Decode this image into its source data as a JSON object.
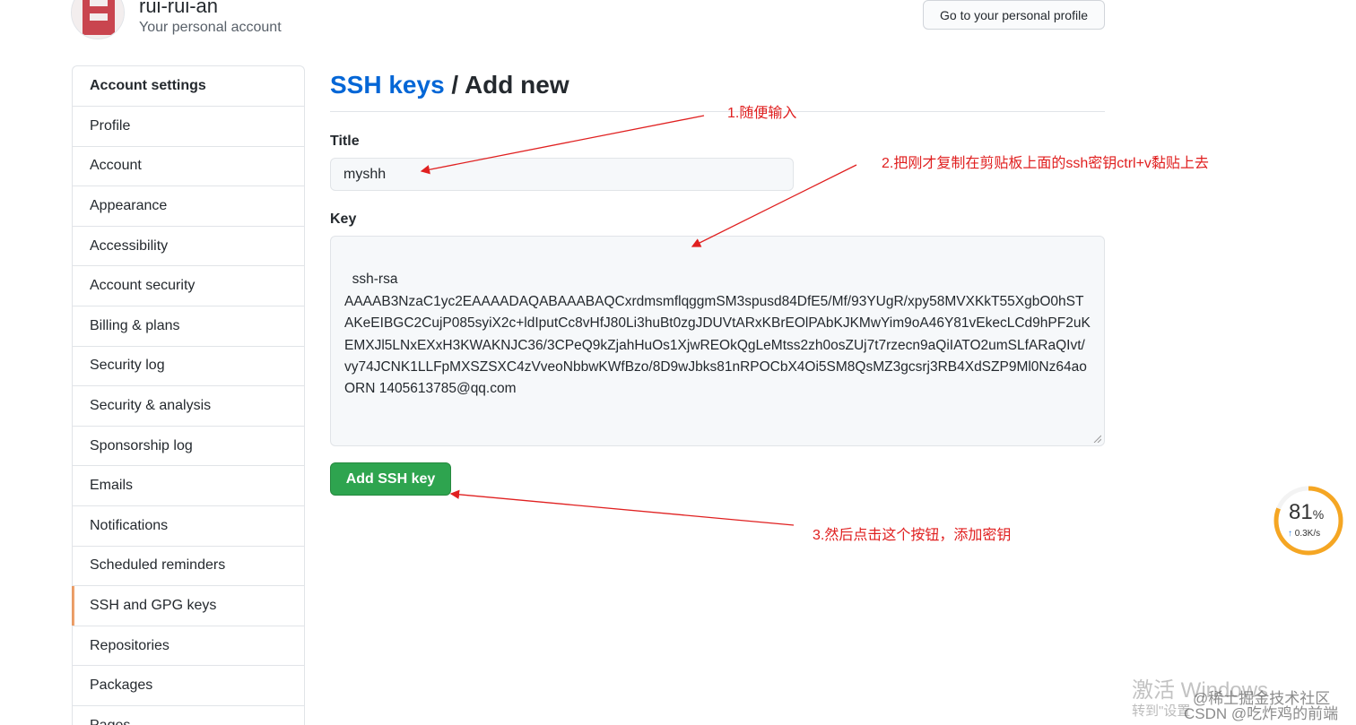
{
  "header": {
    "username": "rui-rui-an",
    "subtitle": "Your personal account",
    "profile_button": "Go to your personal profile"
  },
  "sidebar": {
    "title": "Account settings",
    "items": [
      {
        "label": "Profile"
      },
      {
        "label": "Account"
      },
      {
        "label": "Appearance"
      },
      {
        "label": "Accessibility"
      },
      {
        "label": "Account security"
      },
      {
        "label": "Billing & plans"
      },
      {
        "label": "Security log"
      },
      {
        "label": "Security & analysis"
      },
      {
        "label": "Sponsorship log"
      },
      {
        "label": "Emails"
      },
      {
        "label": "Notifications"
      },
      {
        "label": "Scheduled reminders"
      },
      {
        "label": "SSH and GPG keys",
        "active": true
      },
      {
        "label": "Repositories"
      },
      {
        "label": "Packages"
      },
      {
        "label": "Pages"
      }
    ]
  },
  "main": {
    "breadcrumb_link": "SSH keys",
    "breadcrumb_sep": " / ",
    "breadcrumb_current": "Add new",
    "title_label": "Title",
    "title_value": "myshh",
    "key_label": "Key",
    "key_value": "ssh-rsa\nAAAAB3NzaC1yc2EAAAADAQABAAABAQCxrdmsmflqggmSM3spusd84DfE5/Mf/93YUgR/xpy58MVXKkT55XgbO0hSTAKeEIBGC2CujP085syiX2c+ldIputCc8vHfJ80Li3huBt0zgJDUVtARxKBrEOlPAbKJKMwYim9oA46Y81vEkecLCd9hPF2uKEMXJl5LNxEXxH3KWAKNJC36/3CPeQ9kZjahHuOs1XjwREOkQgLeMtss2zh0osZUj7t7rzecn9aQiIATO2umSLfARaQIvt/vy74JCNK1LLFpMXSZSXC4zVveoNbbwKWfBzo/8D9wJbks81nRPOCbX4Oi5SM8QsMZ3gcsrj3RB4XdSZP9Ml0Nz64aoORN 1405613785@qq.com",
    "submit_label": "Add SSH key"
  },
  "annotations": {
    "step1": "1.随便输入",
    "step2": "2.把刚才复制在剪贴板上面的ssh密钥ctrl+v黏贴上去",
    "step3": "3.然后点击这个按钮，添加密钥",
    "color": "#e02020"
  },
  "speed_widget": {
    "percent": "81",
    "percent_unit": "%",
    "arrow": "↑",
    "speed": "0.3K/s",
    "level": 0.81
  },
  "watermark": {
    "activate": "激活 Windows",
    "goto": "转到\"设置",
    "brand1": "@稀土掘金技术社区",
    "brand2": "CSDN @吃炸鸡的前端"
  },
  "colors": {
    "link": "#0366d6",
    "button_green": "#2ea44f",
    "input_bg": "#f6f8fa",
    "border": "#e1e4e8",
    "gauge": "#f5a623"
  }
}
